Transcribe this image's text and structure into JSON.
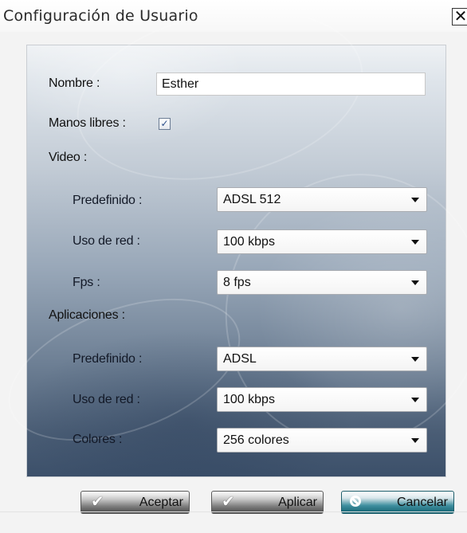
{
  "window": {
    "title": "Configuración de Usuario",
    "close_symbol": "✕"
  },
  "form": {
    "nombre": {
      "label": "Nombre :",
      "value": "Esther"
    },
    "manos_libres": {
      "label": "Manos libres :",
      "checked": true,
      "check_symbol": "✓"
    },
    "video": {
      "label": "Video :",
      "predefinido": {
        "label": "Predefinido :",
        "value": "ADSL 512"
      },
      "uso_de_red": {
        "label": "Uso de red :",
        "value": "100 kbps"
      },
      "fps": {
        "label": "Fps :",
        "value": "8 fps"
      }
    },
    "aplicaciones": {
      "label": "Aplicaciones :",
      "predefinido": {
        "label": "Predefinido :",
        "value": "ADSL"
      },
      "uso_de_red": {
        "label": "Uso de red :",
        "value": "100 kbps"
      },
      "colores": {
        "label": "Colores :",
        "value": "256 colores"
      }
    }
  },
  "buttons": {
    "aceptar": "Aceptar",
    "aplicar": "Aplicar",
    "cancelar": "Cancelar",
    "check_icon": "✔"
  },
  "colors": {
    "panel_top": "#eef1f4",
    "panel_bottom": "#3c506a",
    "cancel_accent": "#12616f"
  }
}
